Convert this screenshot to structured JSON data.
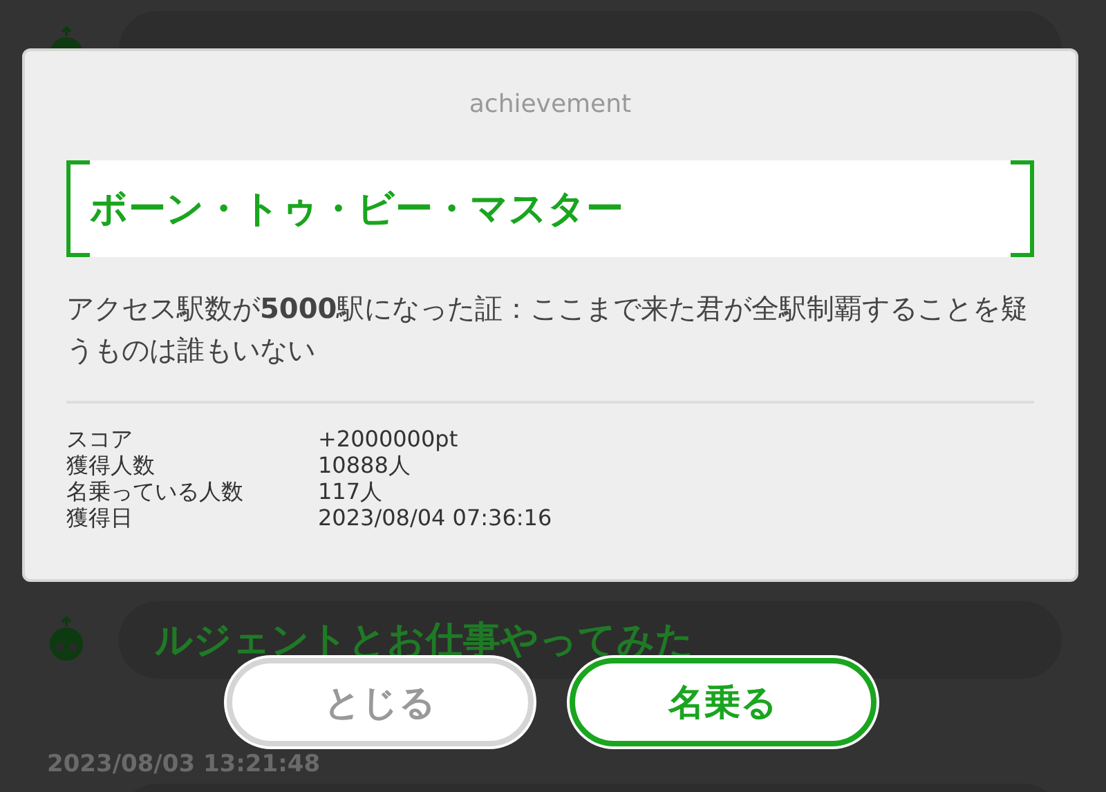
{
  "background_list": [
    {
      "title": "ルジェントとお仕事やってみた",
      "date": "2023/08/03 13:21:48"
    }
  ],
  "dialog": {
    "header": "achievement",
    "title": "ボーン・トゥ・ビー・マスター",
    "description": "アクセス駅数が**5000**駅になった証：ここまで来た君が全駅制覇することを疑うものは誰もいない",
    "stats": [
      {
        "label": "スコア",
        "value": "+2000000pt"
      },
      {
        "label": "獲得人数",
        "value": "10888人"
      },
      {
        "label": "名乗っている人数",
        "value": "117人"
      },
      {
        "label": "獲得日",
        "value": "2023/08/04 07:36:16"
      }
    ]
  },
  "buttons": [
    {
      "label": "とじる",
      "kind": "secondary"
    },
    {
      "label": "名乗る",
      "kind": "primary"
    }
  ]
}
